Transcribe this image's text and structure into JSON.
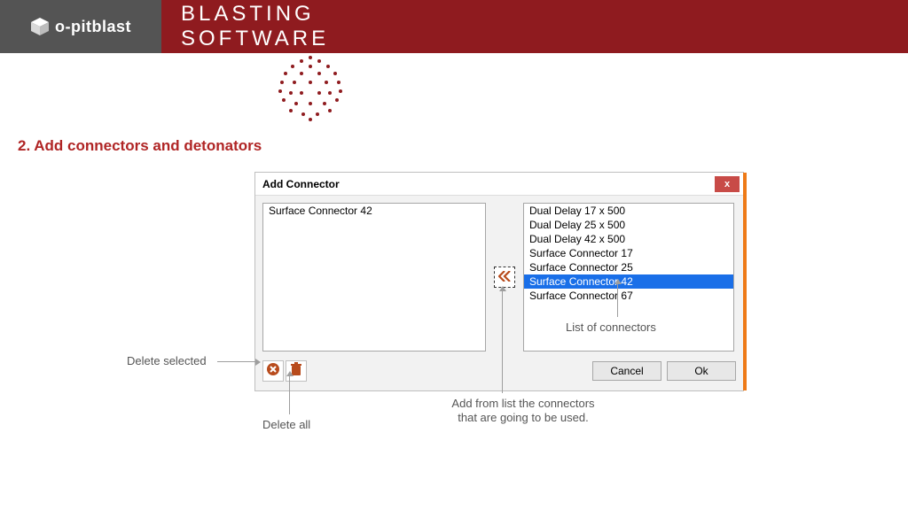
{
  "brand": {
    "name": "o-pitblast"
  },
  "banner": {
    "title": "BLASTING SOFTWARE"
  },
  "section": {
    "heading": "2. Add connectors and detonators"
  },
  "dialog": {
    "title": "Add Connector",
    "close_glyph": "x",
    "selected_items": [
      "Surface Connector 42"
    ],
    "available_items": [
      "Dual Delay 17 x 500",
      "Dual Delay 25 x 500",
      "Dual Delay 42 x 500",
      "Surface Connector 17",
      "Surface Connector 25",
      "Surface Connector 42",
      "Surface Connector 67"
    ],
    "highlighted_index": 5,
    "buttons": {
      "cancel": "Cancel",
      "ok": "Ok"
    }
  },
  "annotations": {
    "delete_selected": "Delete selected",
    "delete_all": "Delete all",
    "add_from_list_l1": "Add from list the connectors",
    "add_from_list_l2": "that are going to be used.",
    "list_of_connectors": "List of connectors"
  }
}
